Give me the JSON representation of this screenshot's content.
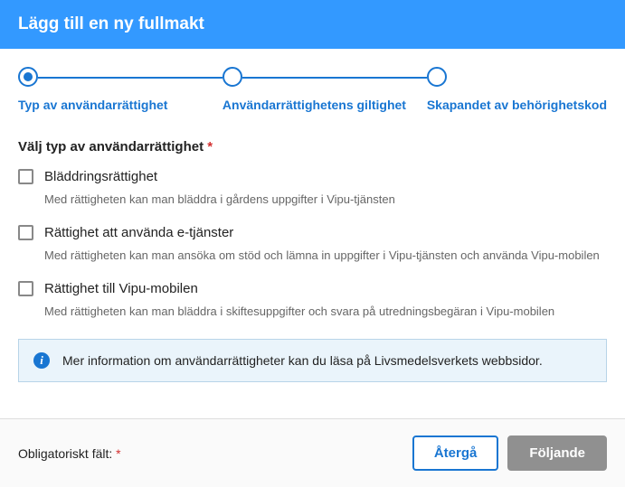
{
  "header": {
    "title": "Lägg till en ny fullmakt"
  },
  "stepper": {
    "steps": [
      {
        "label": "Typ av användarrättighet",
        "active": true
      },
      {
        "label": "Användarrättighetens giltighet",
        "active": false
      },
      {
        "label": "Skapandet av behörighetskod",
        "active": false
      }
    ]
  },
  "section": {
    "title": "Välj typ av användarrättighet",
    "required_mark": "*"
  },
  "options": [
    {
      "label": "Bläddringsrättighet",
      "desc": "Med rättigheten kan man bläddra i gårdens uppgifter i Vipu-tjänsten"
    },
    {
      "label": "Rättighet att använda e-tjänster",
      "desc": "Med rättigheten kan man ansöka om stöd och lämna in uppgifter i Vipu-tjänsten och använda Vipu-mobilen"
    },
    {
      "label": "Rättighet till Vipu-mobilen",
      "desc": "Med rättigheten kan man bläddra i skiftesuppgifter och svara på utredningsbegäran i Vipu-mobilen"
    }
  ],
  "info": {
    "text": "Mer information om användarrättigheter kan du läsa på Livsmedelsverkets webbsidor."
  },
  "footer": {
    "required_label": "Obligatoriskt fält:",
    "required_mark": "*",
    "back": "Återgå",
    "next": "Följande"
  }
}
